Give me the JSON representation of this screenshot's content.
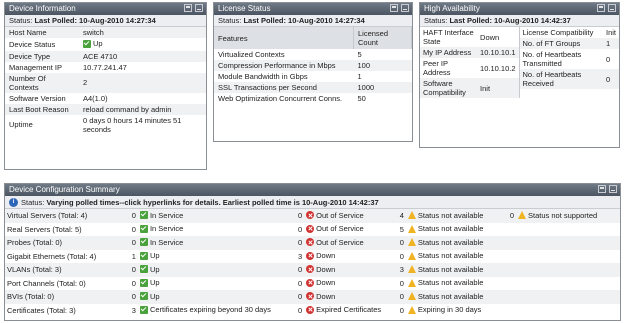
{
  "device_info": {
    "title": "Device Information",
    "status_prefix": "Status:",
    "status": "Last Polled: 10-Aug-2010 14:27:34",
    "rows": [
      {
        "key": "Host Name",
        "value": "switch"
      },
      {
        "key": "Device Status",
        "value": "Up",
        "icon": "ok"
      },
      {
        "key": "Device Type",
        "value": "ACE 4710"
      },
      {
        "key": "Management IP",
        "value": "10.77.241.47"
      },
      {
        "key": "Number Of Contexts",
        "value": "2"
      },
      {
        "key": "Software Version",
        "value": "A4(1.0)"
      },
      {
        "key": "Last Boot Reason",
        "value": "reload command by admin"
      },
      {
        "key": "Uptime",
        "value": "0 days 0 hours 14 minutes 51 seconds"
      }
    ]
  },
  "license": {
    "title": "License Status",
    "status_prefix": "Status:",
    "status": "Last Polled: 10-Aug-2010 14:27:34",
    "headers": [
      "Features",
      "Licensed Count"
    ],
    "rows": [
      {
        "feature": "Virtualized Contexts",
        "count": "5"
      },
      {
        "feature": "Compression Performance in Mbps",
        "count": "100"
      },
      {
        "feature": "Module Bandwidth in Gbps",
        "count": "1"
      },
      {
        "feature": "SSL Transactions per Second",
        "count": "1000"
      },
      {
        "feature": "Web Optimization Concurrent Conns.",
        "count": "50"
      }
    ]
  },
  "ha": {
    "title": "High Availability",
    "status_prefix": "Status:",
    "status": "Last Polled: 10-Aug-2010 14:42:37",
    "left": [
      {
        "key": "HAFT Interface State",
        "value": "Down"
      },
      {
        "key": "My IP Address",
        "value": "10.10.10.1"
      },
      {
        "key": "Peer IP Address",
        "value": "10.10.10.2"
      },
      {
        "key": "Software Compatibility",
        "value": "Init"
      }
    ],
    "right": [
      {
        "key": "License Compatibility",
        "value": "Init"
      },
      {
        "key": "No. of FT Groups",
        "value": "1"
      },
      {
        "key": "No. of Heartbeats Transmitted",
        "value": "0"
      },
      {
        "key": "No. of Heartbeats Received",
        "value": "0"
      }
    ]
  },
  "summary": {
    "title": "Device Configuration Summary",
    "status_prefix": "Status:",
    "status": "Varying polled times--click hyperlinks for details. Earliest polled time is 10-Aug-2010 14:42:37",
    "rows": [
      {
        "label": "Virtual Servers (Total: 4)",
        "cells": [
          {
            "n": "0",
            "icon": "ok",
            "text": "In Service"
          },
          {
            "n": "0",
            "icon": "err",
            "text": "Out of Service"
          },
          {
            "n": "4",
            "icon": "warn",
            "text": "Status not available"
          },
          {
            "n": "0",
            "icon": "warn",
            "text": "Status not supported"
          }
        ]
      },
      {
        "label": "Real Servers (Total: 5)",
        "cells": [
          {
            "n": "0",
            "icon": "ok",
            "text": "In Service"
          },
          {
            "n": "0",
            "icon": "err",
            "text": "Out of Service"
          },
          {
            "n": "5",
            "icon": "warn",
            "text": "Status not available"
          }
        ]
      },
      {
        "label": "Probes (Total: 0)",
        "cells": [
          {
            "n": "0",
            "icon": "ok",
            "text": "In Service"
          },
          {
            "n": "0",
            "icon": "err",
            "text": "Out of Service"
          },
          {
            "n": "0",
            "icon": "warn",
            "text": "Status not available"
          }
        ]
      },
      {
        "label": "Gigabit Ethernets (Total: 4)",
        "cells": [
          {
            "n": "1",
            "icon": "ok",
            "text": "Up"
          },
          {
            "n": "3",
            "icon": "err",
            "text": "Down"
          },
          {
            "n": "0",
            "icon": "warn",
            "text": "Status not available"
          }
        ]
      },
      {
        "label": "VLANs (Total: 3)",
        "cells": [
          {
            "n": "0",
            "icon": "ok",
            "text": "Up"
          },
          {
            "n": "0",
            "icon": "err",
            "text": "Down"
          },
          {
            "n": "3",
            "icon": "warn",
            "text": "Status not available"
          }
        ]
      },
      {
        "label": "Port Channels (Total: 0)",
        "cells": [
          {
            "n": "0",
            "icon": "ok",
            "text": "Up"
          },
          {
            "n": "0",
            "icon": "err",
            "text": "Down"
          },
          {
            "n": "0",
            "icon": "warn",
            "text": "Status not available"
          }
        ]
      },
      {
        "label": "BVIs (Total: 0)",
        "cells": [
          {
            "n": "0",
            "icon": "ok",
            "text": "Up"
          },
          {
            "n": "0",
            "icon": "err",
            "text": "Down"
          },
          {
            "n": "0",
            "icon": "warn",
            "text": "Status not available"
          }
        ]
      },
      {
        "label": "Certificates (Total: 3)",
        "cells": [
          {
            "n": "3",
            "icon": "ok",
            "text": "Certificates expiring beyond 30 days"
          },
          {
            "n": "0",
            "icon": "err",
            "text": "Expired Certificates"
          },
          {
            "n": "0",
            "icon": "warn",
            "text": "Expiring in 30 days"
          }
        ]
      }
    ]
  },
  "colors": {
    "title_bar": "#4a5561",
    "ok": "#49a23b",
    "error": "#d13232",
    "warn": "#f0b323",
    "info": "#2f67b8"
  }
}
